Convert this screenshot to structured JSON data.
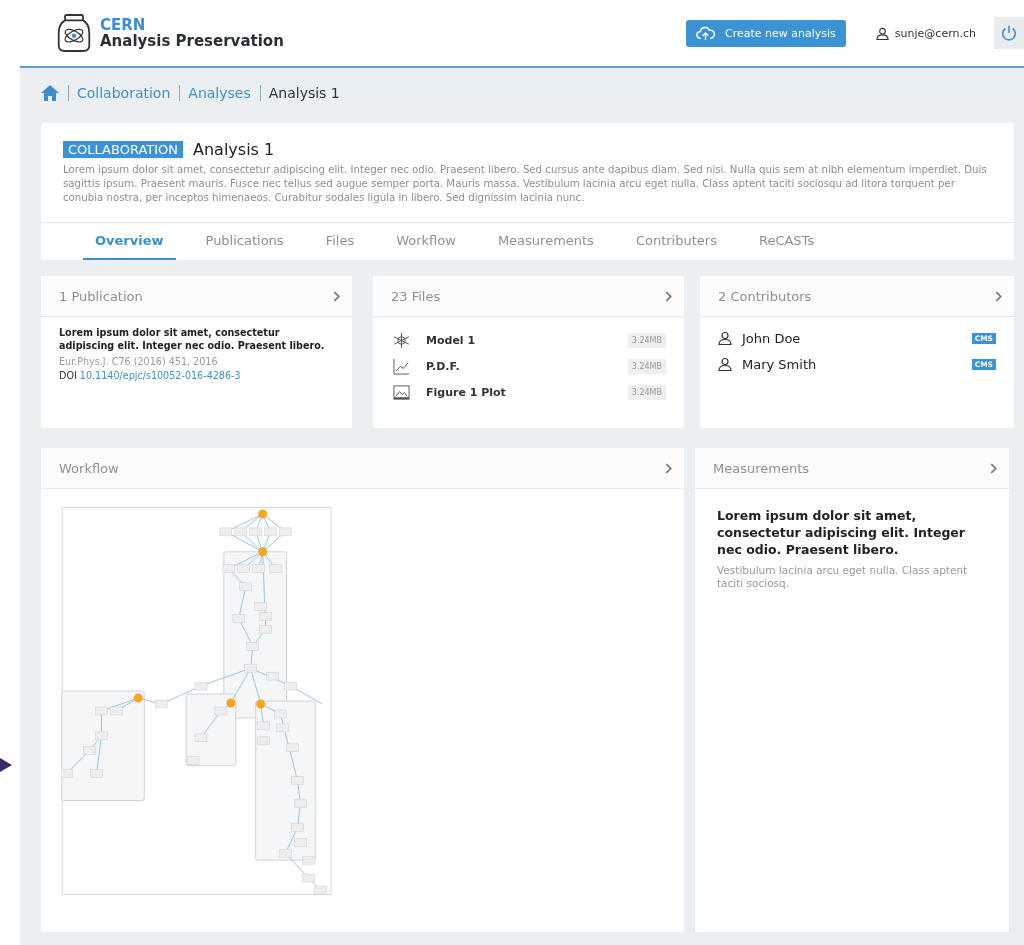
{
  "header": {
    "brand_line1": "CERN",
    "brand_line2": "Analysis Preservation",
    "create_button": "Create new analysis",
    "user": "sunje@cern.ch"
  },
  "breadcrumb": [
    {
      "label": "Collaboration",
      "link": true
    },
    {
      "label": "Analyses",
      "link": true
    },
    {
      "label": "Analysis 1",
      "link": false
    }
  ],
  "analysis": {
    "badge": "COLLABORATION",
    "title": "Analysis 1",
    "description": "Lorem ipsum dolor sit amet, consectetur adipiscing elit. Integer nec odio. Praesent libero. Sed cursus ante dapibus diam. Sed nisi. Nulla quis sem at nibh elementum imperdiet. Duis sagittis ipsum. Praesent mauris. Fusce nec tellus sed augue semper porta. Mauris massa. Vestibulum lacinia arcu eget nulla. Class aptent taciti sociosqu ad litora torquent per conubia nostra, per inceptos himenaeos. Curabitur sodales ligula in libero. Sed dignissim lacinia nunc."
  },
  "tabs": [
    {
      "label": "Overview",
      "selected": true
    },
    {
      "label": "Publications",
      "selected": false
    },
    {
      "label": "Files",
      "selected": false
    },
    {
      "label": "Workflow",
      "selected": false
    },
    {
      "label": "Measurements",
      "selected": false
    },
    {
      "label": "Contributers",
      "selected": false
    },
    {
      "label": "ReCASTs",
      "selected": false
    }
  ],
  "publication_card": {
    "title": "1 Publication",
    "text": "Lorem ipsum dolor sit amet, consectetur adipiscing elit. Integer nec odio. Praesent libero.",
    "journal": "Eur.Phys.J. C76 (2016) 451, 2016",
    "doi_label": "DOI",
    "doi": "10.1140/epjc/s10052-016-4286-3"
  },
  "files_card": {
    "title": "23 Files",
    "files": [
      {
        "kind": "model",
        "name": "Model 1",
        "size": "3.24MB"
      },
      {
        "kind": "chart",
        "name": "P.D.F.",
        "size": "3.24MB"
      },
      {
        "kind": "image",
        "name": "Figure 1 Plot",
        "size": "3.24MB"
      }
    ]
  },
  "contributors_card": {
    "title": "2 Contributors",
    "people": [
      {
        "name": "John Doe",
        "experiment": "CMS"
      },
      {
        "name": "Mary Smith",
        "experiment": "CMS"
      }
    ]
  },
  "workflow_card": {
    "title": "Workflow"
  },
  "measurements_card": {
    "title": "Measurements",
    "lead": "Lorem ipsum dolor sit amet, consectetur adipiscing elit. Integer nec odio. Praesent libero.",
    "note": "Vestibulum lacinia arcu eget nulla. Class aptent taciti sociosq."
  }
}
